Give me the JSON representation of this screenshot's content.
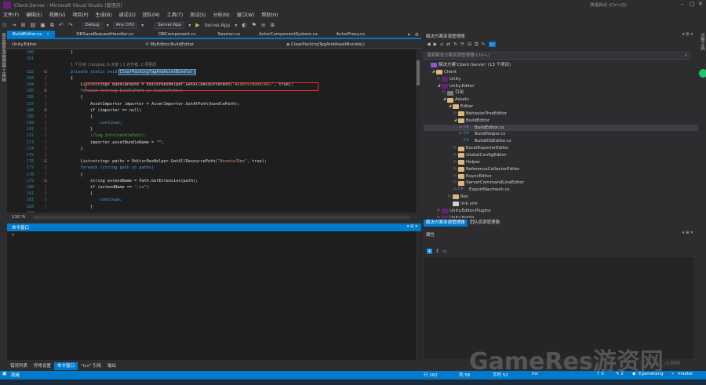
{
  "window": {
    "title": "Client-Server - Microsoft Visual Studio (管理员)",
    "quick_launch": "快速启动 (Ctrl+Q)"
  },
  "menu": [
    "文件(F)",
    "编辑(E)",
    "视图(V)",
    "项目(P)",
    "生成(B)",
    "调试(D)",
    "团队(M)",
    "工具(T)",
    "测试(S)",
    "分析(N)",
    "窗口(W)",
    "帮助(H)"
  ],
  "toolbar": {
    "config": "Debug",
    "platform": "Any CPU",
    "startup": "Server.App",
    "run_label": "Server.App"
  },
  "left_strip": {
    "label": "服务器资源管理器 工具箱"
  },
  "right_strip": {
    "label": "诊断工具"
  },
  "doc_tabs": [
    {
      "label": "BuildEditor.cs",
      "active": true
    },
    {
      "label": "DBSaveRequestHandler.cs",
      "active": false
    },
    {
      "label": "DBComponent.cs",
      "active": false
    },
    {
      "label": "Session.cs",
      "active": false
    },
    {
      "label": "ActorComponentSystem.cs",
      "active": false
    },
    {
      "label": "ActorProxy.cs",
      "active": false
    }
  ],
  "nav": {
    "project": "Unity.Editor",
    "class": "MyEditor.BuildEditor",
    "member": "ClearPackingTagAndAssetBundle()"
  },
  "editor": {
    "line_numbers": [
      "180",
      "181",
      "",
      "182",
      "183",
      "184",
      "185",
      "186",
      "187",
      "188",
      "189",
      "190",
      "191",
      "172",
      "173",
      "174",
      "175",
      "176",
      "177",
      "178",
      "179",
      "180",
      "181",
      "182",
      "183",
      "184",
      "185"
    ],
    "codelens": "1 个引用 | tanghai, 6 天前 | 1 名作者, 2 项更改",
    "lines": {
      "l180": "        }",
      "l181": "",
      "l182a": "        private static void ",
      "l182b": "ClearPackingTagAndAssetBundle()",
      "l183": "        {",
      "l184a": "            List<string> bundlePaths = EditorResHelper.GetAllResourcePath(",
      "l184b": "\"Assets/Bundles/\"",
      "l184c": ", true);",
      "l185": "            foreach (string bundlePath in bundlePaths)",
      "l186": "            {",
      "l187": "                AssetImporter importer = AssetImporter.GetAtPath(bundlePath);",
      "l188": "                if (importer == null)",
      "l189": "                {",
      "l190": "                    continue;",
      "l191": "                }",
      "l172": "                //Log.Info(bundlePath);",
      "l173": "                importer.assetBundleName = \"\";",
      "l174": "            }",
      "l175": "",
      "l176a": "            List<string> paths = EditorResHelper.GetAllResourcePath(",
      "l176b": "\"Assets/Res\"",
      "l176c": ", true);",
      "l177": "            foreach (string path in paths)",
      "l178": "            {",
      "l179a": "                string extendName = Path.GetExtension(path);",
      "l180b1": "                if (extendName == ",
      "l180b2": "\".cs\"",
      "l180b3": ")",
      "l181b": "                {",
      "l182c": "                    continue;",
      "l183b": "                }"
    }
  },
  "zoom": "110 %",
  "command_window": {
    "title": "命令窗口",
    "prompt": ">"
  },
  "bottom_tabs": [
    {
      "label": "错误列表",
      "active": false
    },
    {
      "label": "异常设置",
      "active": false
    },
    {
      "label": "命令窗口",
      "active": true
    },
    {
      "label": "\"tcs\" 引用",
      "active": false
    },
    {
      "label": "输出",
      "active": false
    }
  ],
  "solution_explorer": {
    "title": "解决方案资源管理器",
    "search_placeholder": "搜索解决方案资源管理器(Ctrl+;)",
    "items": [
      {
        "label": "解决方案'Client-Server' (13 个项目)",
        "icon": "sln",
        "depth": 0,
        "arrow": ""
      },
      {
        "label": "Client",
        "icon": "folder",
        "depth": 1,
        "arrow": "◢"
      },
      {
        "label": "Unity",
        "icon": "proj",
        "depth": 2,
        "arrow": "▷"
      },
      {
        "label": "Unity.Editor",
        "icon": "proj",
        "depth": 2,
        "arrow": "◢"
      },
      {
        "label": "引用",
        "icon": "ref",
        "depth": 3,
        "arrow": "▷"
      },
      {
        "label": "Assets",
        "icon": "folder",
        "depth": 3,
        "arrow": "◢"
      },
      {
        "label": "Editor",
        "icon": "folder",
        "depth": 4,
        "arrow": "◢"
      },
      {
        "label": "BehaviorTreeEditor",
        "icon": "folder",
        "depth": 5,
        "arrow": "▷"
      },
      {
        "label": "BuildEditor",
        "icon": "folder",
        "depth": 5,
        "arrow": "◢"
      },
      {
        "label": "BuildEditor.cs",
        "icon": "cs",
        "depth": 6,
        "arrow": "▷",
        "selected": true
      },
      {
        "label": "BuildHelper.cs",
        "icon": "cs",
        "depth": 6,
        "arrow": "▷"
      },
      {
        "label": "BuildIOSEditor.cs",
        "icon": "cs",
        "depth": 6,
        "arrow": ""
      },
      {
        "label": "ExcelExporterEditor",
        "icon": "folder",
        "depth": 5,
        "arrow": "▷"
      },
      {
        "label": "GlobalConfigEditor",
        "icon": "folder",
        "depth": 5,
        "arrow": "▷"
      },
      {
        "label": "Helper",
        "icon": "folder",
        "depth": 5,
        "arrow": "▷"
      },
      {
        "label": "ReferenceCollectorEditor",
        "icon": "folder",
        "depth": 5,
        "arrow": "▷"
      },
      {
        "label": "RsyncEditor",
        "icon": "folder",
        "depth": 5,
        "arrow": "▷"
      },
      {
        "label": "ServerCommandLineEditor",
        "icon": "folder",
        "depth": 5,
        "arrow": "▷"
      },
      {
        "label": "ExportNavmesh.cs",
        "icon": "cs",
        "depth": 5,
        "arrow": "▷"
      },
      {
        "label": "Res",
        "icon": "folder",
        "depth": 4,
        "arrow": "▷"
      },
      {
        "label": "link.xml",
        "icon": "xml",
        "depth": 4,
        "arrow": ""
      },
      {
        "label": "Unity.Editor.Plugins",
        "icon": "proj",
        "depth": 2,
        "arrow": "▷"
      },
      {
        "label": "Unity.Hotfix",
        "icon": "proj",
        "depth": 2,
        "arrow": "▷"
      }
    ],
    "tabs": [
      {
        "label": "解决方案资源管理器",
        "active": true
      },
      {
        "label": "团队资源管理器",
        "active": false
      }
    ]
  },
  "properties": {
    "title": "属性"
  },
  "status": {
    "ready": "就绪",
    "row": "行 162",
    "col": "列 58",
    "ch": "字符 52",
    "ins": "Ins",
    "up": "↑ 0",
    "pencil": "✎ 2",
    "user": "Egametang",
    "branch": "master"
  },
  "watermark": {
    "text": "GameRes游资网",
    "sub": ".com"
  },
  "colors": {
    "accent": "#007acc",
    "background": "#2d2d30",
    "editor": "#1e1e1e",
    "highlight_box": "#e03030"
  }
}
